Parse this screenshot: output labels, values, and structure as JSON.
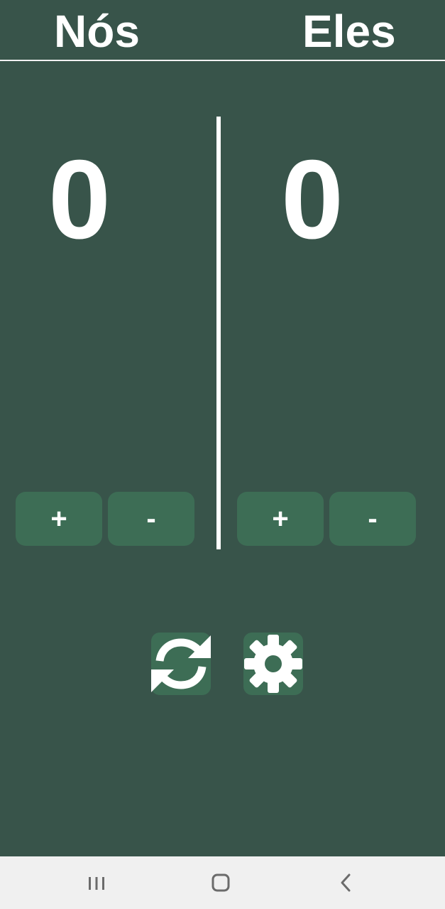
{
  "header": {
    "team_us": "Nós",
    "team_them": "Eles"
  },
  "scores": {
    "us": "0",
    "them": "0"
  },
  "controls": {
    "plus_label": "+",
    "minus_label": "-"
  },
  "actions": {
    "reset_icon": "refresh-icon",
    "settings_icon": "gear-icon"
  },
  "navbar": {
    "recents_icon": "recent-apps-icon",
    "home_icon": "home-icon",
    "back_icon": "back-chevron-icon"
  },
  "colors": {
    "background": "#38544a",
    "button": "#3d6d55",
    "text": "#ffffff",
    "navbar": "#f0f0f0",
    "nav_icon": "#6b6b6b"
  }
}
